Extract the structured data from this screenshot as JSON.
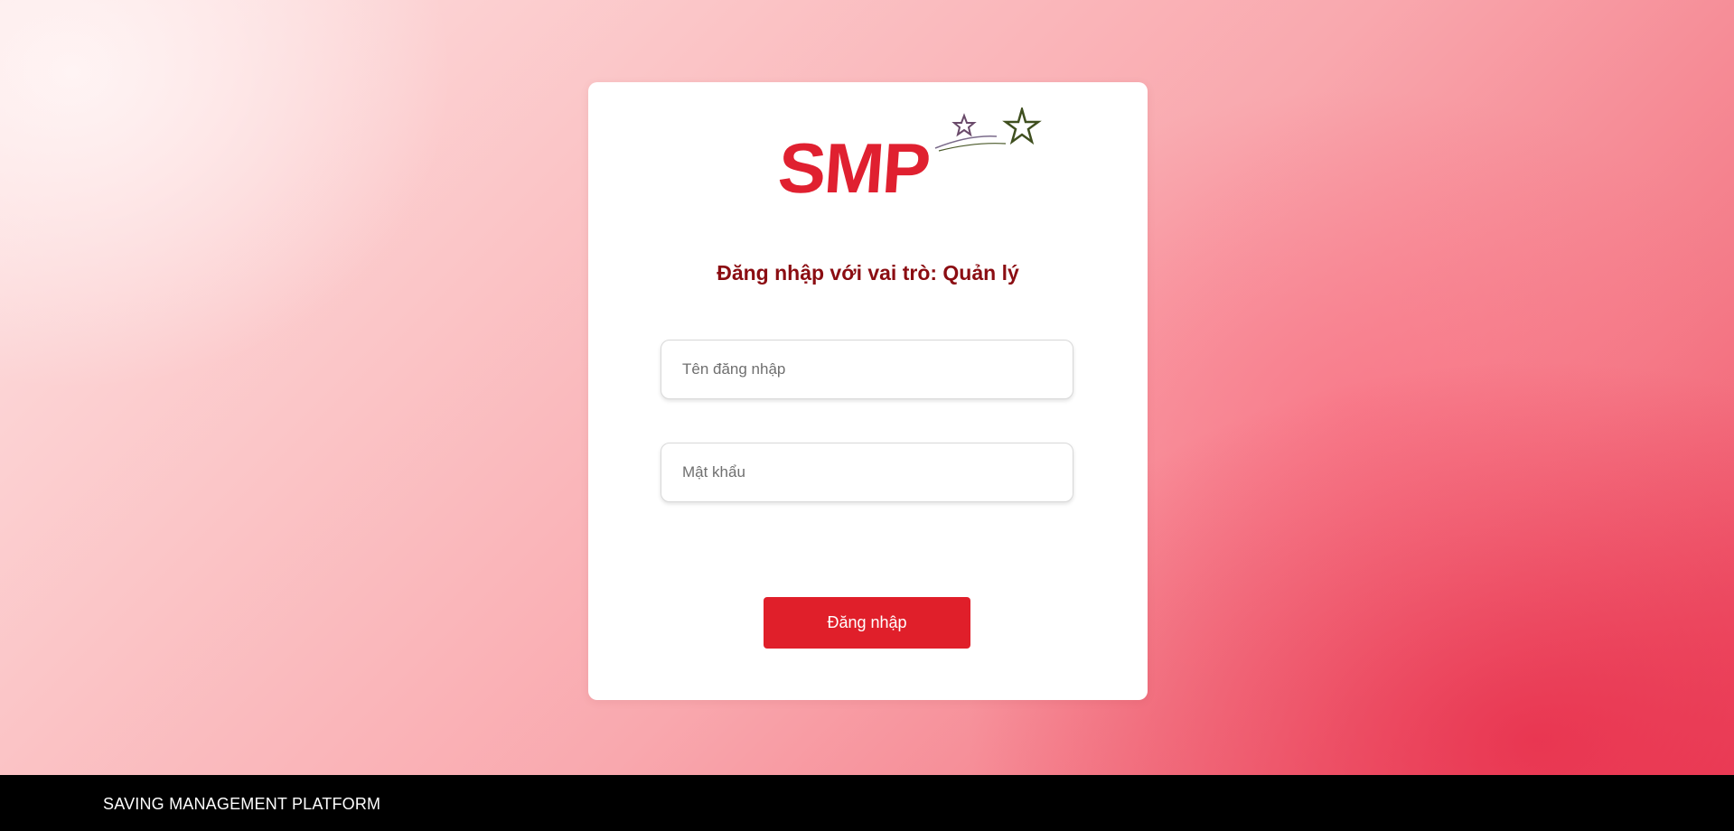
{
  "logo": {
    "text": "SMP",
    "icon": "shooting-stars-icon",
    "brand_color": "#e02030"
  },
  "login": {
    "title": "Đăng nhập với vai trò: Quản lý",
    "username_placeholder": "Tên đăng nhập",
    "username_value": "",
    "password_placeholder": "Mật khẩu",
    "password_value": "",
    "submit_label": "Đăng nhập"
  },
  "footer": {
    "text": "SAVING MANAGEMENT PLATFORM"
  },
  "colors": {
    "title": "#8b0d12",
    "button": "#e01f2a",
    "footer_bg": "#000000"
  }
}
